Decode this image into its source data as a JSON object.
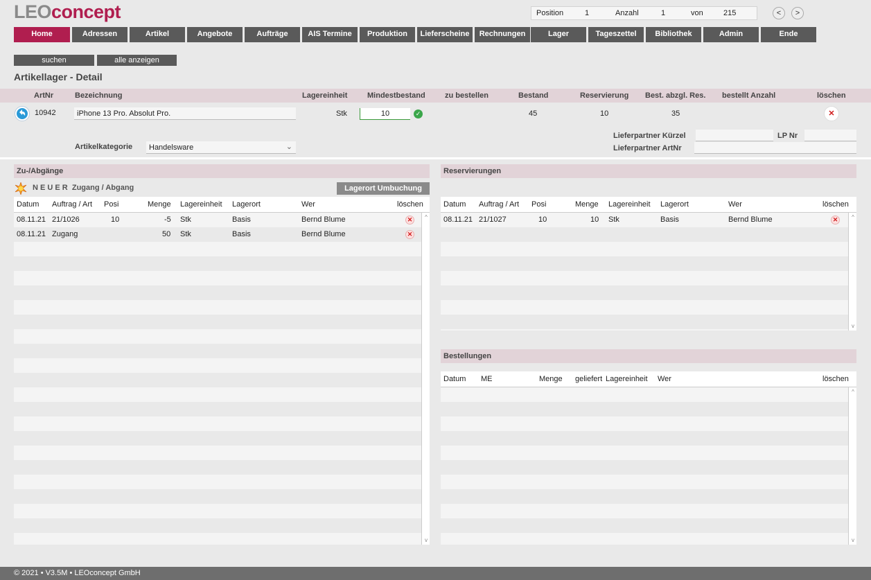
{
  "logo": {
    "part1": "LEO",
    "part2": "concept"
  },
  "position_bar": {
    "position_label": "Position",
    "position_value": "1",
    "anzahl_label": "Anzahl",
    "anzahl_value": "1",
    "von_label": "von",
    "von_value": "215"
  },
  "nav": {
    "prev": "<",
    "next": ">"
  },
  "menu": [
    "Home",
    "Adressen",
    "Artikel",
    "Angebote",
    "Aufträge",
    "AIS Termine",
    "Produktion",
    "Lieferscheine",
    "Rechnungen",
    "Lager",
    "Tageszettel",
    "Bibliothek",
    "Admin",
    "Ende"
  ],
  "buttons": {
    "search": "suchen",
    "show_all": "alle anzeigen",
    "relocate": "Lagerort Umbuchung"
  },
  "page_title": "Artikellager - Detail",
  "article_header": {
    "artnr": "ArtNr",
    "bezeichnung": "Bezeichnung",
    "lagereinheit": "Lagereinheit",
    "mindestbestand": "Mindestbestand",
    "zu_bestellen": "zu bestellen",
    "bestand": "Bestand",
    "reservierung": "Reservierung",
    "best_abzgl": "Best. abzgl. Res.",
    "bestellt": "bestellt Anzahl",
    "loeschen": "löschen"
  },
  "article": {
    "artnr": "10942",
    "bezeichnung": "iPhone 13 Pro. Absolut Pro.",
    "lagereinheit": "Stk",
    "mindestbestand": "10",
    "bestand": "45",
    "reservierung": "10",
    "best_abzgl": "35"
  },
  "kategorie": {
    "label": "Artikelkategorie",
    "value": "Handelsware"
  },
  "lieferpartner": {
    "kuerzel_label": "Lieferpartner Kürzel",
    "lpnr_label": "LP Nr",
    "artnr_label": "Lieferpartner ArtNr"
  },
  "zu_abgaenge": {
    "title": "Zu-/Abgänge",
    "new_prefix": "N E U E R",
    "new_label": "Zugang / Abgang",
    "columns": [
      "Datum",
      "Auftrag / Art",
      "Posi",
      "Menge",
      "Lagereinheit",
      "Lagerort",
      "Wer",
      "löschen"
    ],
    "rows": [
      {
        "datum": "08.11.21",
        "auftrag": "21/1026",
        "posi": "10",
        "menge": "-5",
        "le": "Stk",
        "ort": "Basis",
        "wer": "Bernd Blume"
      },
      {
        "datum": "08.11.21",
        "auftrag": "Zugang",
        "posi": "",
        "menge": "50",
        "le": "Stk",
        "ort": "Basis",
        "wer": "Bernd Blume"
      }
    ]
  },
  "reservierungen": {
    "title": "Reservierungen",
    "columns": [
      "Datum",
      "Auftrag / Art",
      "Posi",
      "Menge",
      "Lagereinheit",
      "Lagerort",
      "Wer",
      "löschen"
    ],
    "rows": [
      {
        "datum": "08.11.21",
        "auftrag": "21/1027",
        "posi": "10",
        "menge": "10",
        "le": "Stk",
        "ort": "Basis",
        "wer": "Bernd Blume"
      }
    ]
  },
  "bestellungen": {
    "title": "Bestellungen",
    "columns": [
      "Datum",
      "ME",
      "Menge",
      "geliefert",
      "Lagereinheit",
      "Wer",
      "löschen"
    ]
  },
  "footer": "© 2021 • V3.5M • LEOconcept GmbH",
  "colors": {
    "accent": "#b01e4f",
    "menu": "#5a5a5a",
    "header_band": "#e2d3d8"
  }
}
